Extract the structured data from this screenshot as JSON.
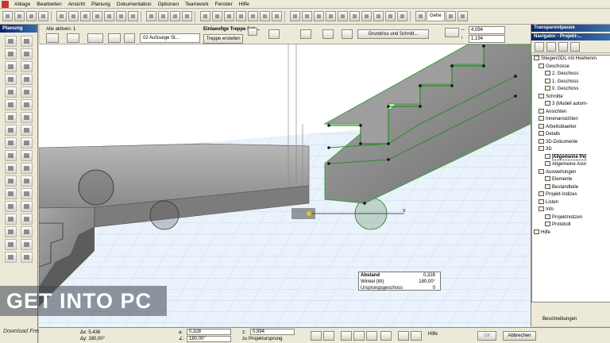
{
  "menu": [
    "Ablage",
    "Bearbeiten",
    "Ansicht",
    "Planung",
    "Dokumentation",
    "Optionen",
    "Teamwork",
    "Fenster",
    "Hilfe"
  ],
  "toolbar": {
    "left_label": "Transparentpause",
    "right_dropdown": "Gehe"
  },
  "toolbox": {
    "title": "Planung"
  },
  "infobox": {
    "selection_label": "Alle aktiven: 1",
    "story_dropdown": "02 Aufzuege St...",
    "stair_title": "Einlaeufige Treppe Sch...",
    "create_stair_button": "Treppe erstellen",
    "plan_section_button": "Grundriss und Schnitt...",
    "field_1": "4,094",
    "field_2": "1,194"
  },
  "tracker": {
    "rows": [
      {
        "key": "Abstand",
        "value": "0,328"
      },
      {
        "key": "Winkel (W)",
        "value": "180,00°"
      },
      {
        "key": "Ursprungsgeschoss",
        "value": "0"
      }
    ]
  },
  "watermark": {
    "text": "GET INTO PC",
    "sub": "Download Free Your Desired App"
  },
  "navigator": {
    "top_label": "Transparentpause",
    "title": "Navigator - Projekt-...",
    "tree": [
      {
        "label": "StiegenGDL mit Hoehenm",
        "level": 0
      },
      {
        "label": "Geschosse",
        "level": 1
      },
      {
        "label": "2. Geschoss",
        "level": 2
      },
      {
        "label": "1. Geschoss",
        "level": 2
      },
      {
        "label": "0. Geschoss",
        "level": 2
      },
      {
        "label": "Schnitte",
        "level": 1
      },
      {
        "label": "3 (Modell autom-",
        "level": 2
      },
      {
        "label": "Ansichten",
        "level": 1
      },
      {
        "label": "Innenansichten",
        "level": 1
      },
      {
        "label": "Arbeitsblaetter",
        "level": 1
      },
      {
        "label": "Details",
        "level": 1
      },
      {
        "label": "3D-Dokumente",
        "level": 1
      },
      {
        "label": "3D",
        "level": 1
      },
      {
        "label": "Allgemeine Pe",
        "level": 2,
        "selected": true
      },
      {
        "label": "Allgemeine Axor",
        "level": 2
      },
      {
        "label": "Auswertungen",
        "level": 1
      },
      {
        "label": "Elemente",
        "level": 2
      },
      {
        "label": "Bestandteile",
        "level": 2
      },
      {
        "label": "Projekt-Indizes",
        "level": 1
      },
      {
        "label": "Listen",
        "level": 1
      },
      {
        "label": "Info",
        "level": 1
      },
      {
        "label": "Projektnotizen",
        "level": 2
      },
      {
        "label": "Protokoll",
        "level": 2
      },
      {
        "label": "Hilfe",
        "level": 0
      }
    ],
    "footer": "Beschreibungen"
  },
  "status": {
    "dx": "Δx: 5,436",
    "dy": "Δy: 180,00°",
    "ax_label": "a:",
    "ax_value": "0,328",
    "ay_label": "∠:",
    "ay_value": "180,00°",
    "z_label": "z:",
    "z_value": "0,994",
    "z_note": "zu Projektursprung",
    "help_label": "Hilfe",
    "ok_button": "OK",
    "cancel_button": "Abbrechen"
  }
}
